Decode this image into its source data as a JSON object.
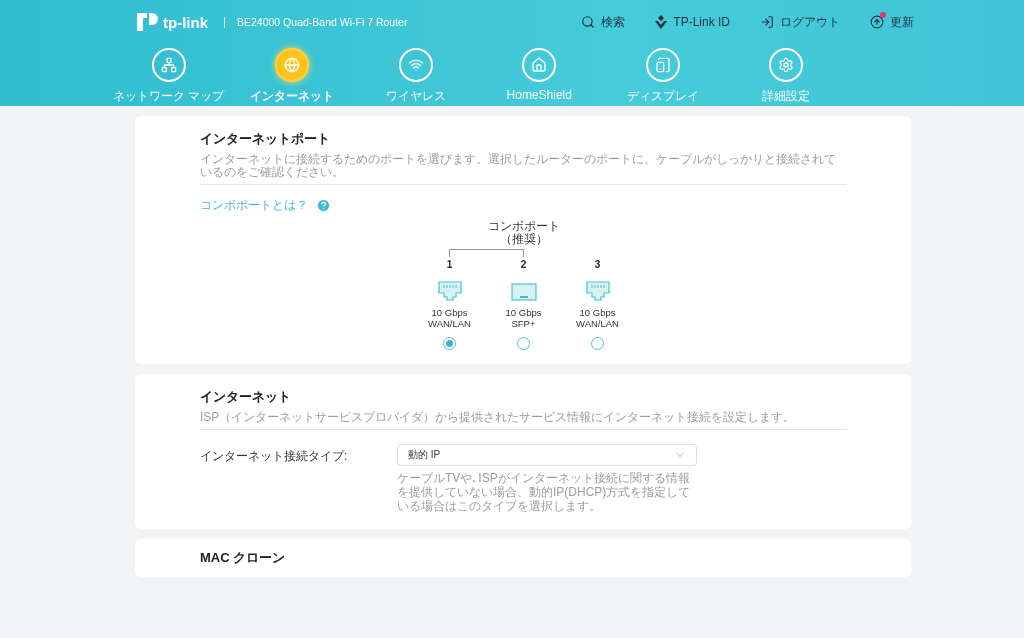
{
  "header": {
    "logo": "tp-link",
    "model": "BE24000 Quad-Band Wi-Fi 7 Router",
    "actions": [
      {
        "kind": "search",
        "label": "検索",
        "alert": false
      },
      {
        "kind": "account",
        "label": "TP-Link ID",
        "alert": false
      },
      {
        "kind": "logout",
        "label": "ログアウト",
        "alert": false
      },
      {
        "kind": "update",
        "label": "更新",
        "alert": true
      }
    ]
  },
  "nav": [
    {
      "kind": "network",
      "label": "ネットワーク マップ",
      "selected": false
    },
    {
      "kind": "internet",
      "label": "インターネット",
      "selected": true
    },
    {
      "kind": "wireless",
      "label": "ワイヤレス",
      "selected": false
    },
    {
      "kind": "homeshield",
      "label": "HomeShield",
      "selected": false
    },
    {
      "kind": "display",
      "label": "ディスプレイ",
      "selected": false
    },
    {
      "kind": "advanced",
      "label": "詳細設定",
      "selected": false
    }
  ],
  "port_card": {
    "title": "インターネットポート",
    "description": "インターネットに接続するためのポートを選びます。選択したルーターのポートに、ケーブルがしっかりと接続されているのをご確認ください。",
    "help_link": "コンボポートとは？",
    "combo_label": "コンボポート（推奨）",
    "ports": [
      {
        "number": "1",
        "kind": "rj45",
        "speed": "10 Gbps",
        "type": "WAN/LAN",
        "combo": true,
        "selected": true
      },
      {
        "number": "2",
        "kind": "sfp",
        "speed": "10 Gbps",
        "type": "SFP+",
        "combo": true,
        "selected": false
      },
      {
        "number": "3",
        "kind": "rj45",
        "speed": "10 Gbps",
        "type": "WAN/LAN",
        "combo": false,
        "selected": false
      }
    ]
  },
  "internet_card": {
    "title": "インターネット",
    "description": "ISP（インターネットサービスプロバイダ）から提供されたサービス情報にインターネット接続を設定します。",
    "field_label": "インターネット接続タイプ:",
    "value": "動的 IP",
    "hint": "ケーブルTVや､ISPがインターネット接続に関する情報を提供していない場合、動的IP(DHCP)方式を指定している場合はこのタイプを選択します。"
  },
  "mac_card": {
    "title": "MAC クローン"
  }
}
